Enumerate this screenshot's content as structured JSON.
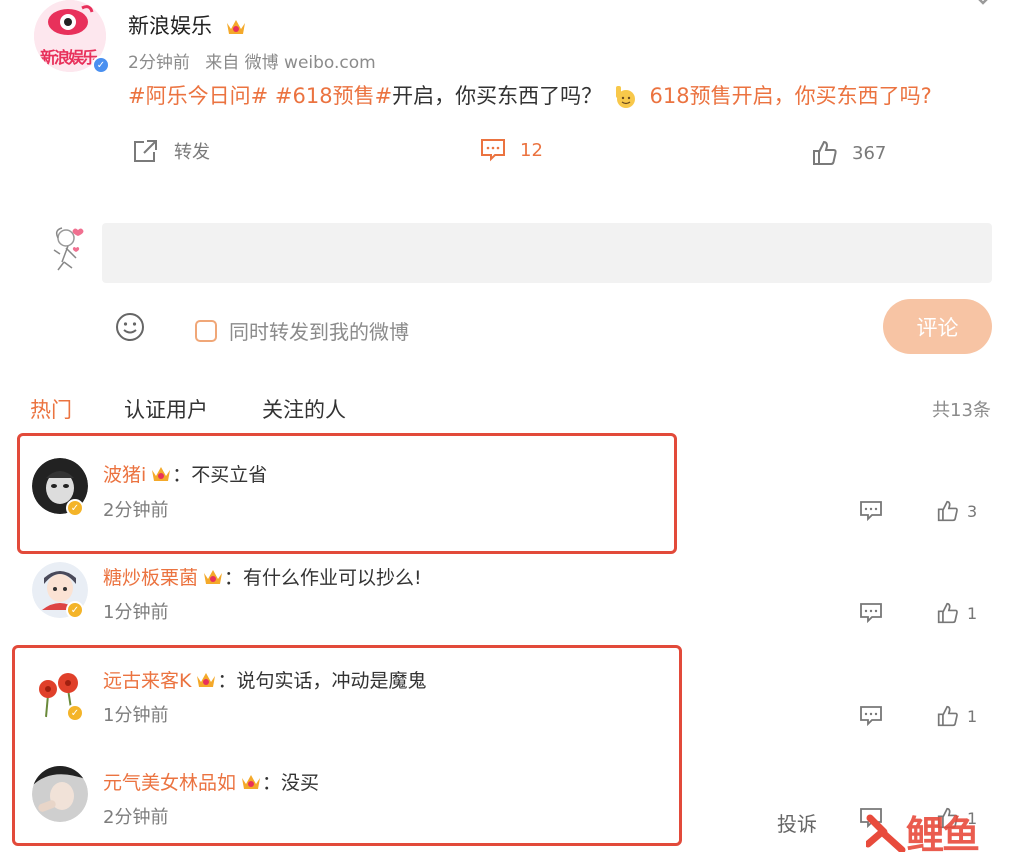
{
  "post": {
    "author": "新浪娱乐",
    "avatar_text": "新浪娱乐",
    "time": "2分钟前",
    "source": "来自 微博 weibo.com",
    "topic1": "#阿乐今日问#",
    "topic2": "#618预售#",
    "text_main": "开启，你买东西了吗？",
    "link_text": "618预售开启，你买东西了吗?",
    "repost_label": "转发",
    "comment_count": "12",
    "like_count": "367"
  },
  "compose": {
    "placeholder": "",
    "repost_check_label": "同时转发到我的微博",
    "submit_label": "评论"
  },
  "tabs": {
    "hot": "热门",
    "verified": "认证用户",
    "following": "关注的人",
    "total": "共13条"
  },
  "comments": [
    {
      "name": "波猪i",
      "sep": "：",
      "text": "不买立省",
      "time": "2分钟前",
      "likes": "3"
    },
    {
      "name": "糖炒板栗菌",
      "sep": "：",
      "text": "有什么作业可以抄么!",
      "time": "1分钟前",
      "likes": "1"
    },
    {
      "name": "远古来客K",
      "sep": "：",
      "text": "说句实话，冲动是魔鬼",
      "time": "1分钟前",
      "likes": "1"
    },
    {
      "name": "元气美女林品如",
      "sep": "：",
      "text": "没买",
      "time": "2分钟前",
      "likes": "1",
      "report_label": "投诉"
    }
  ],
  "watermark": "鲤鱼",
  "colors": {
    "accent": "#eb7340",
    "highlight": "#e24a3a",
    "submit_bg": "#f7c4a4"
  }
}
